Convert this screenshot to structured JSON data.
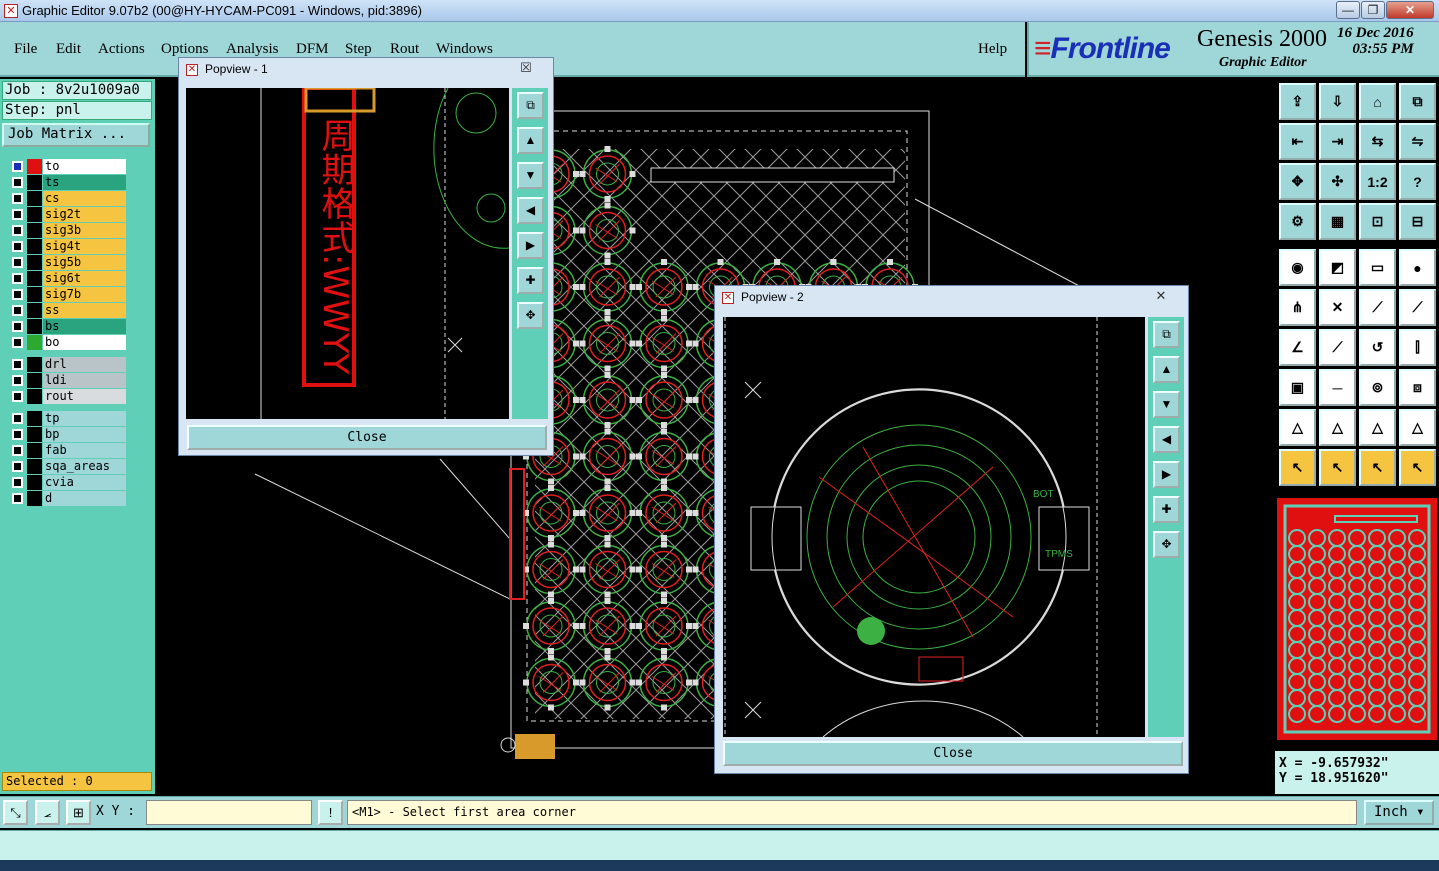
{
  "window": {
    "title": "Graphic Editor 9.07b2 (00@HY-HYCAM-PC091 - Windows, pid:3896)",
    "icon": "graphic-editor-icon",
    "min_label": "—",
    "max_label": "❐",
    "close_label": "✕"
  },
  "menu": [
    "File",
    "Edit",
    "Actions",
    "Options",
    "Analysis",
    "DFM",
    "Step",
    "Rout",
    "Windows"
  ],
  "help_label": "Help",
  "brand": {
    "logo": "Frontline",
    "product": "Genesis 2000",
    "subtitle": "Graphic Editor",
    "date": "16 Dec 2016",
    "time": "03:55 PM"
  },
  "job": {
    "job_label": "Job : 8v2u1009a0",
    "step_label": "Step: pnl",
    "matrix_label": "Job Matrix ..."
  },
  "layers": [
    {
      "name": "to",
      "color": "#ffffff",
      "swatch": "#e01010",
      "active": true
    },
    {
      "name": "ts",
      "color": "#2aa37f",
      "swatch": "#000000"
    },
    {
      "name": "cs",
      "color": "#f5c542",
      "swatch": "#000000"
    },
    {
      "name": "sig2t",
      "color": "#f5c542",
      "swatch": "#000000"
    },
    {
      "name": "sig3b",
      "color": "#f5c542",
      "swatch": "#000000"
    },
    {
      "name": "sig4t",
      "color": "#f5c542",
      "swatch": "#000000"
    },
    {
      "name": "sig5b",
      "color": "#f5c542",
      "swatch": "#000000"
    },
    {
      "name": "sig6t",
      "color": "#f5c542",
      "swatch": "#000000"
    },
    {
      "name": "sig7b",
      "color": "#f5c542",
      "swatch": "#000000"
    },
    {
      "name": "ss",
      "color": "#f5c542",
      "swatch": "#000000"
    },
    {
      "name": "bs",
      "color": "#2aa37f",
      "swatch": "#000000"
    },
    {
      "name": "bo",
      "color": "#ffffff",
      "swatch": "#2ea82e"
    },
    {
      "name": "drl",
      "color": "#b9c4c8",
      "swatch": "#000000"
    },
    {
      "name": "ldi",
      "color": "#b9c4c8",
      "swatch": "#000000"
    },
    {
      "name": "rout",
      "color": "#d8dcde",
      "swatch": "#000000"
    },
    {
      "name": "tp",
      "color": "#9fd6d8",
      "swatch": "#000000"
    },
    {
      "name": "bp",
      "color": "#9fd6d8",
      "swatch": "#000000"
    },
    {
      "name": "fab",
      "color": "#9fd6d8",
      "swatch": "#000000"
    },
    {
      "name": "sqa_areas",
      "color": "#9fd6d8",
      "swatch": "#000000"
    },
    {
      "name": "cvia",
      "color": "#9fd6d8",
      "swatch": "#000000"
    },
    {
      "name": "d",
      "color": "#9fd6d8",
      "swatch": "#000000"
    }
  ],
  "selected": "Selected : 0",
  "popview1": {
    "title": "Popview - 1",
    "close": "Close",
    "close_x": "☒",
    "text": "周期格式:WWYY"
  },
  "popview2": {
    "title": "Popview - 2",
    "close": "Close",
    "close_x": "✕",
    "labels": {
      "t1": "TPMS",
      "t2": "BOT"
    }
  },
  "coords": {
    "x": "X = -9.657932\"",
    "y": "Y = 18.951620\""
  },
  "cmd": {
    "xy_label": "X Y :",
    "xy_value": "",
    "prompt": "<M1> - Select first area corner",
    "unit": "Inch",
    "warn": "!"
  },
  "toolbar_tooltips": [
    "open-step",
    "save",
    "home",
    "window",
    "prev",
    "next",
    "split",
    "toggle",
    "fit",
    "zoom",
    "one-to-one",
    "query"
  ],
  "ratio_label": "1:2"
}
